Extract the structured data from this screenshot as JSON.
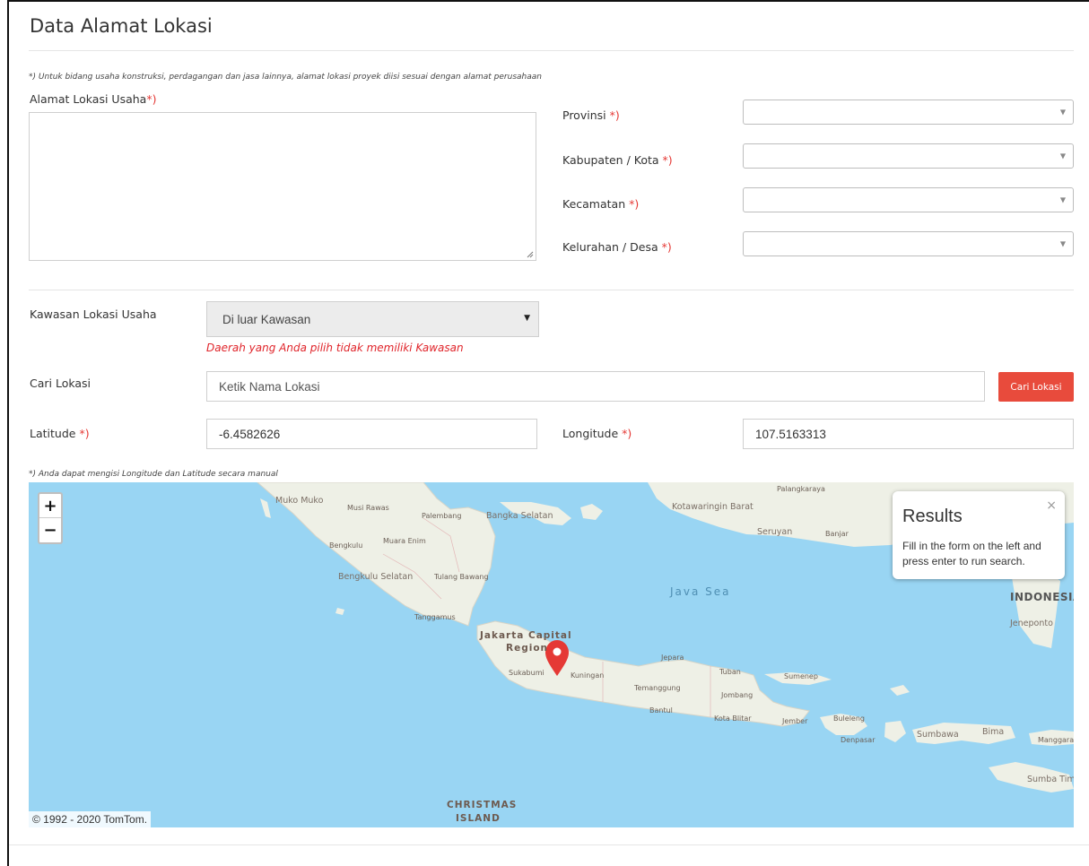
{
  "section": {
    "title": "Data Alamat Lokasi"
  },
  "notes": {
    "top": "*) Untuk bidang usaha konstruksi, perdagangan dan jasa lainnya, alamat lokasi proyek diisi sesuai dengan alamat perusahaan",
    "bottom": "*) Anda dapat mengisi Longitude dan Latitude secara manual"
  },
  "required_mark": "*)",
  "address": {
    "label": "Alamat Lokasi Usaha",
    "value": ""
  },
  "region": {
    "provinsi": {
      "label": "Provinsi",
      "value": ""
    },
    "kabupaten": {
      "label": "Kabupaten / Kota",
      "value": ""
    },
    "kecamatan": {
      "label": "Kecamatan",
      "value": ""
    },
    "kelurahan": {
      "label": "Kelurahan / Desa",
      "value": ""
    }
  },
  "kawasan": {
    "label": "Kawasan Lokasi Usaha",
    "value": "Di luar Kawasan",
    "warning": "Daerah yang Anda pilih tidak memiliki Kawasan"
  },
  "search": {
    "label": "Cari Lokasi",
    "placeholder": "Ketik Nama Lokasi",
    "button": "Cari Lokasi"
  },
  "coords": {
    "lat_label": "Latitude",
    "lat_value": "-6.4582626",
    "lon_label": "Longitude",
    "lon_value": "107.5163313"
  },
  "map": {
    "zoom_in": "+",
    "zoom_out": "−",
    "attribution": "© 1992 - 2020 TomTom.",
    "results": {
      "title": "Results",
      "body": "Fill in the form on the left and press enter to run search.",
      "close": "×"
    },
    "labels": {
      "muko": "Muko Muko",
      "musi": "Musi Rawas",
      "palembang": "Palembang",
      "bangka": "Bangka Selatan",
      "bengkulu": "Bengkulu",
      "muaraenim": "Muara Enim",
      "bengkulu_sel": "Bengkulu Selatan",
      "tulang": "Tulang Bawang",
      "tanggamus": "Tanggamus",
      "jakarta1": "Jakarta Capital",
      "jakarta2": "Region",
      "sukabumi": "Sukabumi",
      "kuningan": "Kuningan",
      "jepara": "Jepara",
      "tuban": "Tuban",
      "sumenep": "Sumenep",
      "temanggung": "Temanggung",
      "jombang": "Jombang",
      "bantul": "Bantul",
      "kotablitar": "Kota Blitar",
      "jember": "Jember",
      "buleleng": "Buleleng",
      "denpasar": "Denpasar",
      "sumbawa": "Sumbawa",
      "bima": "Bima",
      "manggarai": "Manggarai",
      "sumbatimur": "Sumba Timu",
      "palangkaraya": "Palangkaraya",
      "kotawaringin": "Kotawaringin Barat",
      "seruyan": "Seruyan",
      "banjar": "Banjar",
      "javasea": "Java Sea",
      "indonesia": "INDONESIA",
      "jeneponto": "Jeneponto",
      "christmas1": "CHRISTMAS",
      "christmas2": "ISLAND"
    }
  },
  "colors": {
    "accent": "#e84b3c",
    "required": "#e53935",
    "sea": "#99d5f3",
    "land": "#eef0e6",
    "pin": "#e53935"
  }
}
